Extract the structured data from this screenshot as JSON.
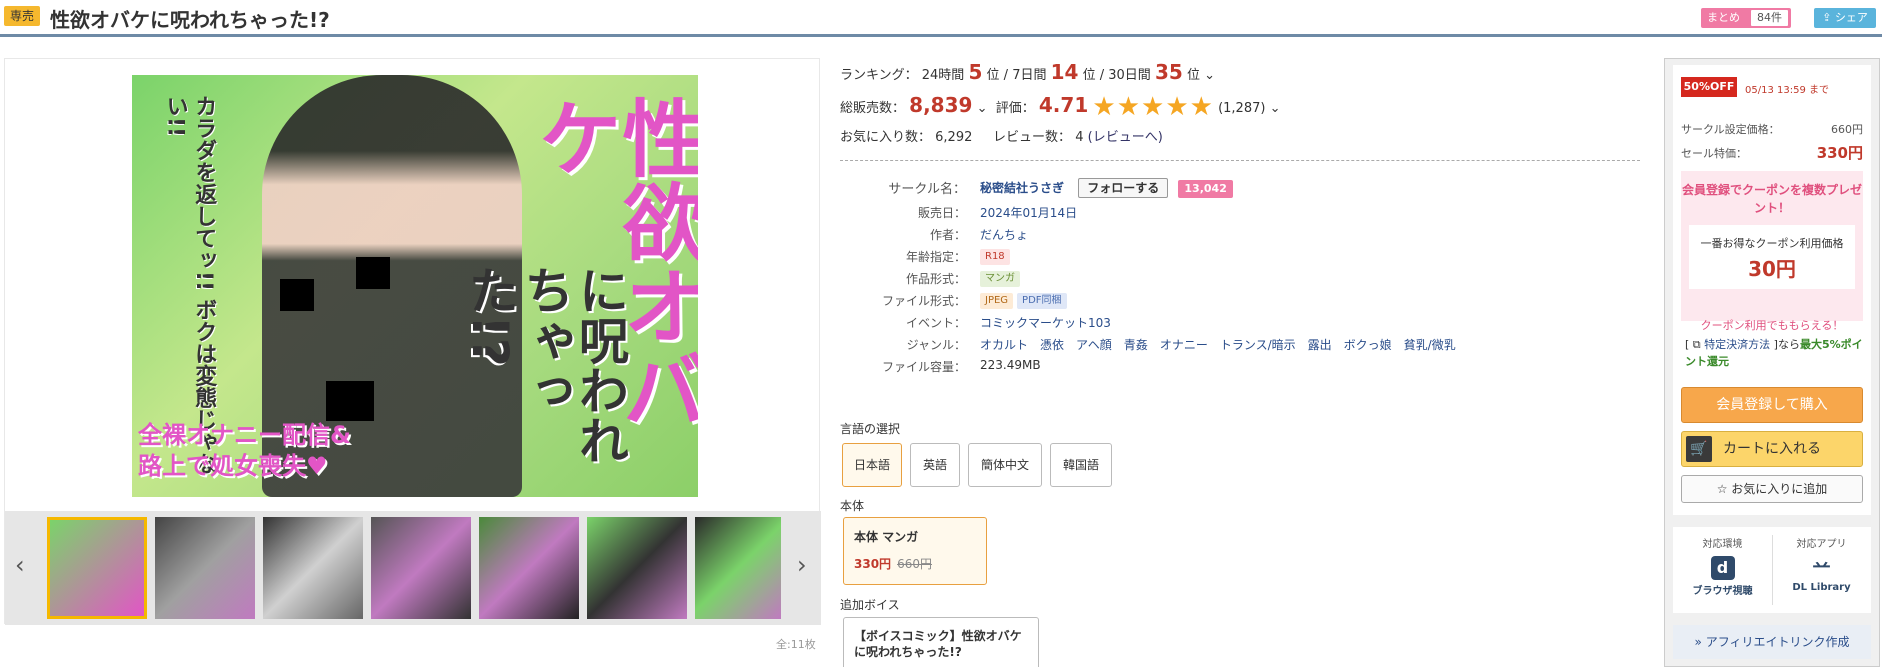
{
  "header": {
    "badge": "専売",
    "title": "性欲オバケに呪われちゃった!?",
    "matome_label": "まとめ",
    "matome_count": "84件",
    "share_label": "シェア"
  },
  "cover": {
    "title_main": "性欲オバケ",
    "title_sub": "に呪われちゃった!?",
    "tagline": "カラダを返してッ!! ボクは変態じゃない!!",
    "bottom_line1": "全裸オナニー配信&",
    "bottom_line2": "路上で処女喪失♥"
  },
  "gallery": {
    "prev_icon": "‹",
    "next_icon": "›",
    "total": "全:11枚"
  },
  "ranking": {
    "label": "ランキング：",
    "d24_label": "24時間",
    "d24_value": "5",
    "d7_label": "7日間",
    "d7_value": "14",
    "d30_label": "30日間",
    "d30_value": "35",
    "unit": "位"
  },
  "sales": {
    "label": "総販売数：",
    "value": "8,839",
    "rating_label": "評価：",
    "rating_value": "4.71",
    "stars": "★★★★★",
    "rating_count": "(1,287)"
  },
  "favorites": {
    "fav_label": "お気に入り数：",
    "fav_value": "6,292",
    "review_label": "レビュー数：",
    "review_value": "4",
    "review_link": "(レビューへ)"
  },
  "spec": {
    "circle_label": "サークル名",
    "circle_value": "秘密結社うさぎ",
    "follow_label": "フォローする",
    "follow_count": "13,042",
    "release_label": "販売日",
    "release_value": "2024年01月14日",
    "author_label": "作者",
    "author_value": "だんちょ",
    "age_label": "年齢指定",
    "age_value": "R18",
    "form_label": "作品形式",
    "form_value": "マンガ",
    "file_label": "ファイル形式",
    "file_value1": "JPEG",
    "file_value2": "PDF同梱",
    "event_label": "イベント",
    "event_value": "コミックマーケット103",
    "genre_label": "ジャンル",
    "genres": [
      "オカルト",
      "憑依",
      "アヘ顔",
      "青姦",
      "オナニー",
      "トランス/暗示",
      "露出",
      "ボクっ娘",
      "貧乳/微乳"
    ],
    "size_label": "ファイル容量",
    "size_value": "223.49MB"
  },
  "language": {
    "label": "言語の選択",
    "options": [
      "日本語",
      "英語",
      "簡体中文",
      "韓国語"
    ]
  },
  "edition": {
    "label": "本体",
    "title": "本体 マンガ",
    "price": "330円",
    "orig_price": "660円"
  },
  "voice": {
    "label": "追加ボイス",
    "title": "【ボイスコミック】性欲オバケに呪われちゃった!?"
  },
  "purchase": {
    "off_badge": "50%OFF",
    "off_date": "05/13 13:59 まで",
    "set_price_label": "サークル設定価格：",
    "set_price": "660円",
    "sale_price_label": "セール特価：",
    "sale_price": "330円",
    "coupon_heading": "会員登録でクーポンを複数プレゼント！",
    "coupon_inner_label": "一番お得なクーポン利用価格",
    "coupon_price": "30円",
    "coupon_note": "クーポン利用でももらえる！",
    "pay_note_a": "[ ",
    "pay_link": "特定決済方法",
    "pay_note_b": " ]なら",
    "pay_bonus": "最大5%ポイント還元",
    "buy_label": "会員登録して購入",
    "cart_label": "カートに入れる",
    "fav_label": "お気に入りに追加",
    "env_label": "対応環境",
    "env_name": "ブラウザ視聴",
    "app_label": "対応アプリ",
    "app_name": "DL Library",
    "affiliate_label": "» アフィリエイトリンク作成"
  },
  "colors": {
    "accent_red": "#c0392b",
    "star": "#f5a623",
    "pink": "#f07aa4",
    "header_rule": "#6e8aa6"
  }
}
